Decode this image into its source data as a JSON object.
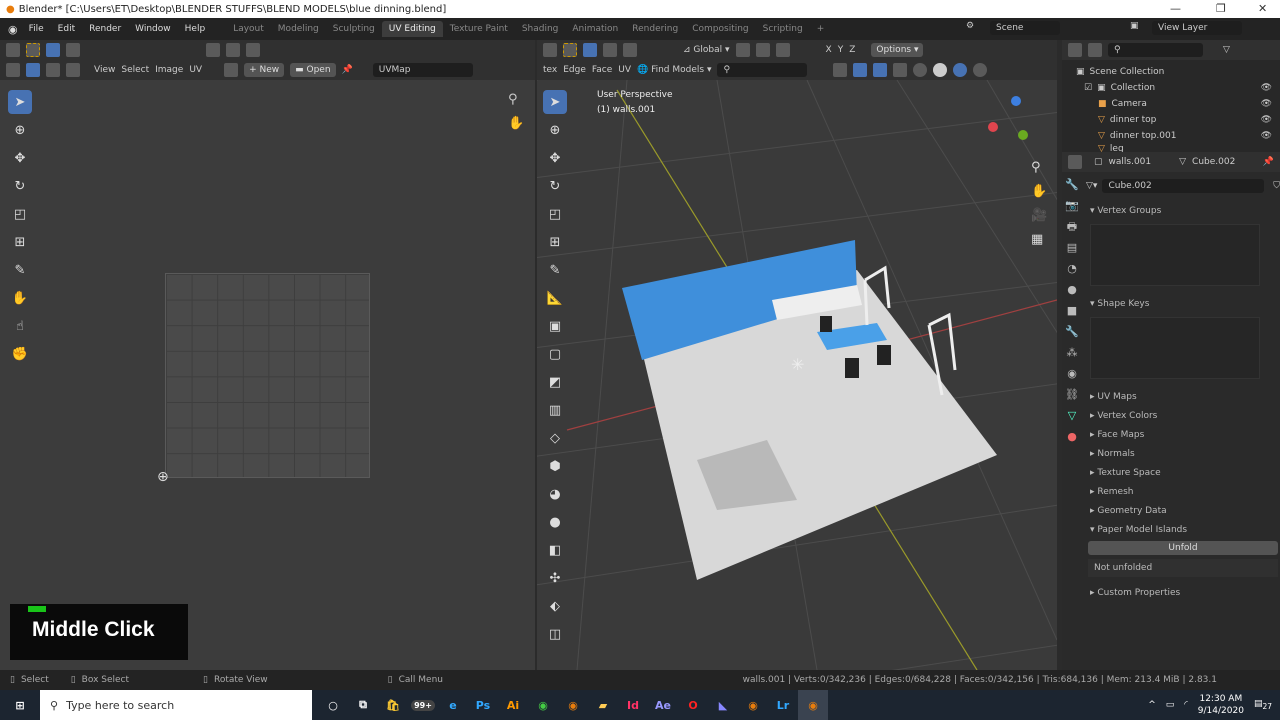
{
  "window": {
    "title": "Blender* [C:\\Users\\ET\\Desktop\\BLENDER STUFFS\\BLEND MODELS\\blue dinning.blend]",
    "minimize": "—",
    "restore": "❐",
    "close": "✕"
  },
  "menu": [
    "File",
    "Edit",
    "Render",
    "Window",
    "Help"
  ],
  "workspaces": [
    {
      "label": "Layout"
    },
    {
      "label": "Modeling"
    },
    {
      "label": "Sculpting"
    },
    {
      "label": "UV Editing",
      "active": true
    },
    {
      "label": "Texture Paint"
    },
    {
      "label": "Shading"
    },
    {
      "label": "Animation"
    },
    {
      "label": "Rendering"
    },
    {
      "label": "Compositing"
    },
    {
      "label": "Scripting"
    }
  ],
  "add_workspace": "+",
  "scene": {
    "name": "Scene",
    "view_layer": "View Layer"
  },
  "uv_editor": {
    "menus": [
      "View",
      "Select",
      "Image",
      "UV"
    ],
    "new_label": "New",
    "open_label": "Open",
    "uv_map": "UVMap"
  },
  "viewport": {
    "menus": [
      "tex",
      "Edge",
      "Face",
      "UV"
    ],
    "find_models": "Find Models",
    "orientation": "Global",
    "options": "Options",
    "axes": [
      "X",
      "Y",
      "Z"
    ],
    "perspective": "User Perspective",
    "object_label": "(1) walls.001"
  },
  "outliner": {
    "root": "Scene Collection",
    "items": [
      {
        "name": "Collection",
        "type": "collection"
      },
      {
        "name": "Camera",
        "type": "camera"
      },
      {
        "name": "dinner top",
        "type": "mesh"
      },
      {
        "name": "dinner top.001",
        "type": "mesh"
      },
      {
        "name": "leg",
        "type": "mesh"
      }
    ]
  },
  "properties": {
    "object": "walls.001",
    "mesh": "Cube.002",
    "mesh_field": "Cube.002",
    "panels_top": [
      "Vertex Groups",
      "Shape Keys"
    ],
    "panels": [
      "UV Maps",
      "Vertex Colors",
      "Face Maps",
      "Normals",
      "Texture Space",
      "Remesh",
      "Geometry Data",
      "Paper Model Islands"
    ],
    "unfold_label": "Unfold",
    "unfold_status": "Not unfolded",
    "custom": "Custom Properties"
  },
  "status": {
    "select": "Select",
    "box_select": "Box Select",
    "rotate": "Rotate View",
    "call_menu": "Call Menu",
    "stats": "walls.001 | Verts:0/342,236 | Edges:0/684,228 | Faces:0/342,156 | Tris:684,136 | Mem: 213.4 MiB | 2.83.1"
  },
  "taskbar": {
    "search_placeholder": "Type here to search",
    "time": "12:30 AM",
    "date": "9/14/2020",
    "notifications": "27",
    "badge": "99+",
    "apps": [
      "Ps",
      "Ai",
      "Id",
      "Ae",
      "Lr"
    ]
  },
  "overlay": {
    "text": "Middle Click",
    "color": "#19c419"
  },
  "colors": {
    "accent": "#4772b3",
    "wall": "#3f8fdb"
  }
}
